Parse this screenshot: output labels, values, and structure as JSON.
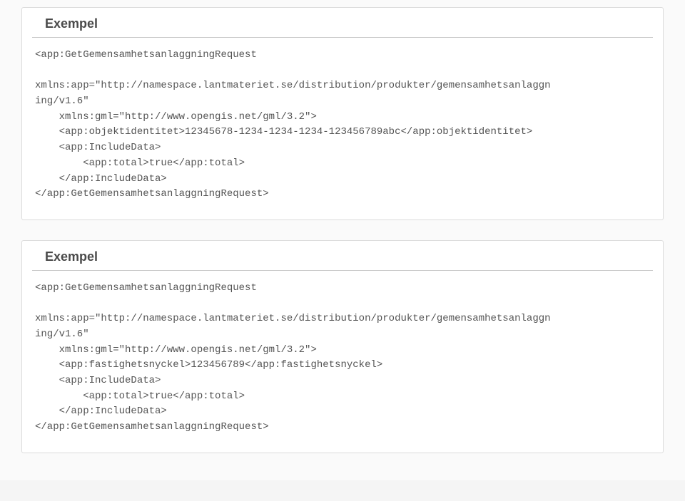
{
  "examples": [
    {
      "title": "Exempel",
      "code": "<app:GetGemensamhetsanlaggningRequest\n\nxmlns:app=\"http://namespace.lantmateriet.se/distribution/produkter/gemensamhetsanlaggn\ning/v1.6\"\n    xmlns:gml=\"http://www.opengis.net/gml/3.2\">\n    <app:objektidentitet>12345678-1234-1234-1234-123456789abc</app:objektidentitet>\n    <app:IncludeData>\n        <app:total>true</app:total>\n    </app:IncludeData>\n</app:GetGemensamhetsanlaggningRequest>"
    },
    {
      "title": "Exempel",
      "code": "<app:GetGemensamhetsanlaggningRequest\n\nxmlns:app=\"http://namespace.lantmateriet.se/distribution/produkter/gemensamhetsanlaggn\ning/v1.6\"\n    xmlns:gml=\"http://www.opengis.net/gml/3.2\">\n    <app:fastighetsnyckel>123456789</app:fastighetsnyckel>\n    <app:IncludeData>\n        <app:total>true</app:total>\n    </app:IncludeData>\n</app:GetGemensamhetsanlaggningRequest>"
    }
  ]
}
